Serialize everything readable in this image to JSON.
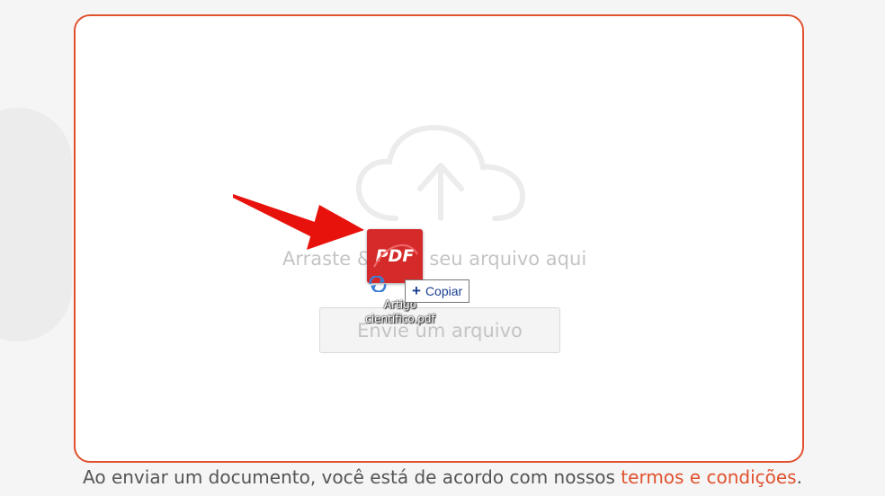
{
  "dropzone": {
    "drop_text": "Arraste & solte seu arquivo aqui",
    "upload_button_label": "Envie um arquivo",
    "icon": "cloud-upload-icon"
  },
  "drag_ghost": {
    "icon_label": "PDF",
    "file_name": "Artigo científico.pdf",
    "copy_tooltip": "Copiar",
    "copy_icon": "plus-icon"
  },
  "footer": {
    "text": "Ao enviar um documento, você está de acordo com nossos ",
    "link_label": "termos e condições",
    "end": "."
  },
  "colors": {
    "accent": "#e0512e",
    "pdf_red": "#d52a2a",
    "arrow_red": "#e8120c"
  }
}
